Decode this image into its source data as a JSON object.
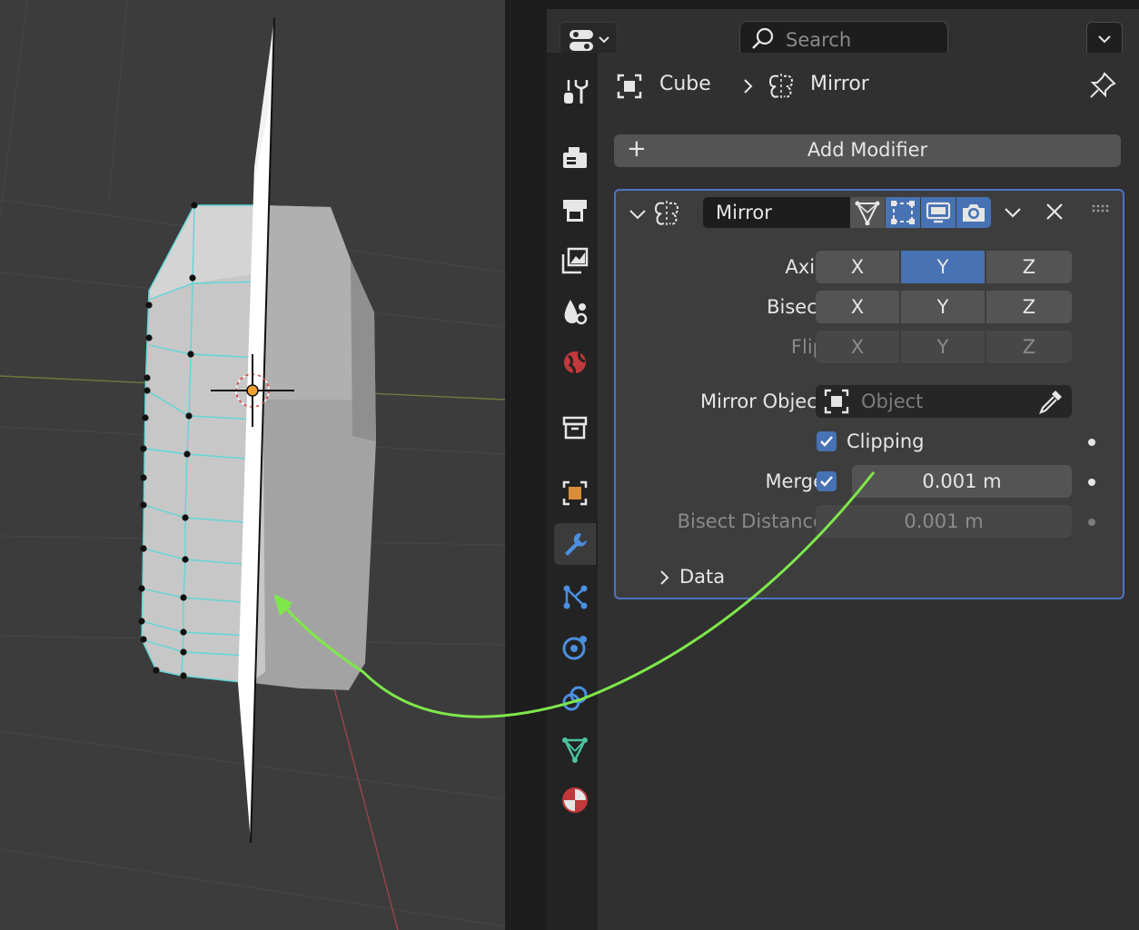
{
  "search": {
    "placeholder": "Search"
  },
  "breadcrumb": {
    "object": "Cube",
    "modifier": "Mirror"
  },
  "add_modifier": {
    "label": "Add Modifier"
  },
  "modifier": {
    "name": "Mirror",
    "axis": {
      "label": "Axis",
      "options": [
        "X",
        "Y",
        "Z"
      ],
      "active": "Y"
    },
    "bisect": {
      "label": "Bisect",
      "options": [
        "X",
        "Y",
        "Z"
      ]
    },
    "flip": {
      "label": "Flip",
      "options": [
        "X",
        "Y",
        "Z"
      ]
    },
    "mirror_object": {
      "label": "Mirror Object",
      "placeholder": "Object"
    },
    "clipping": {
      "label": "Clipping",
      "checked": true
    },
    "merge": {
      "label": "Merge",
      "checked": true,
      "value": "0.001 m"
    },
    "bisect_distance": {
      "label": "Bisect Distance",
      "value": "0.001 m"
    },
    "data_section": {
      "label": "Data"
    }
  },
  "colors": {
    "accent": "#4772b3",
    "panel_outline": "#4c73c2",
    "annotation_arrow": "#7ee84a",
    "mesh_edge": "#5fd6d6"
  },
  "tabs": [
    "tool-icon",
    "render-icon",
    "output-icon",
    "view-layer-icon",
    "scene-icon",
    "world-icon",
    "collection-icon",
    "object-icon",
    "modifier-icon",
    "particles-icon",
    "physics-icon",
    "constraints-icon",
    "data-icon",
    "material-icon"
  ]
}
